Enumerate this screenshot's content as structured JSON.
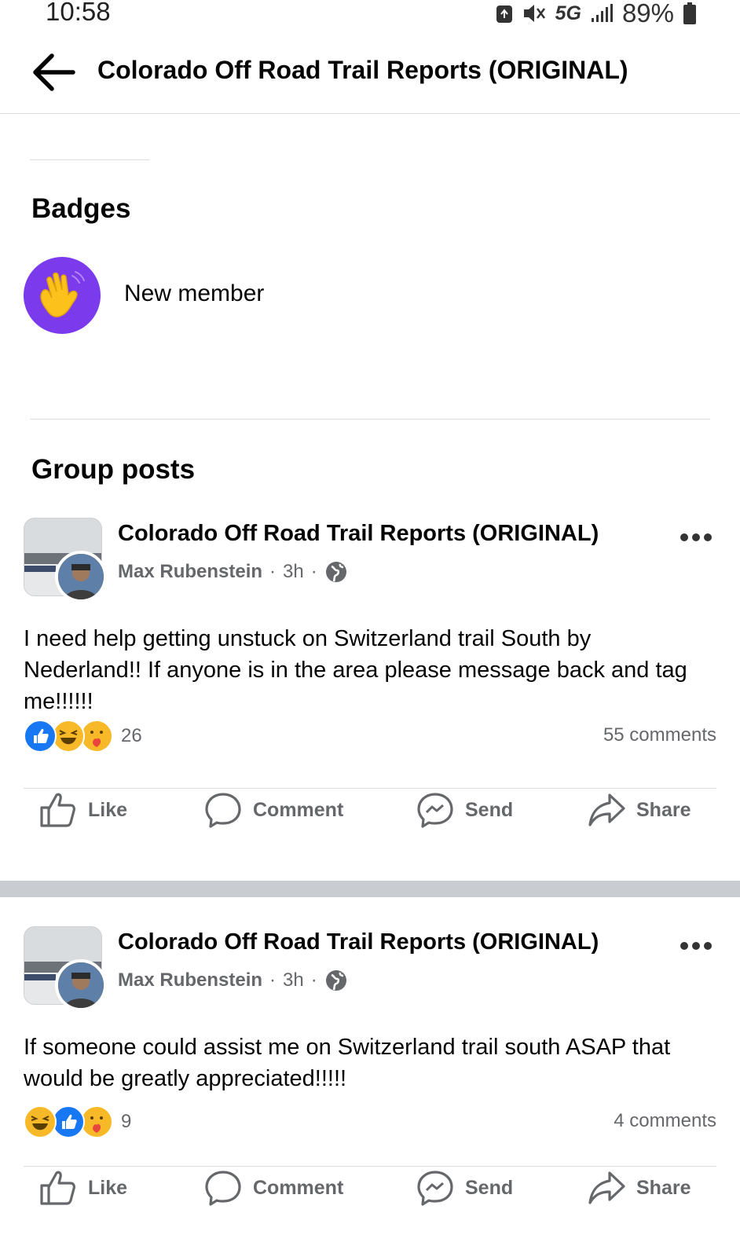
{
  "status_bar": {
    "time": "10:58",
    "network": "5G",
    "battery": "89%"
  },
  "header": {
    "title": "Colorado Off Road Trail Reports (ORIGINAL)"
  },
  "badges": {
    "title": "Badges",
    "items": [
      {
        "label": "New member",
        "icon": "waving-hand-icon"
      }
    ]
  },
  "group_posts": {
    "title": "Group posts",
    "posts": [
      {
        "group": "Colorado Off Road Trail Reports (ORIGINAL)",
        "author": "Max Rubenstein",
        "time": "3h",
        "text": "I need help getting unstuck on Switzerland trail South by Nederland!! If anyone is in the area please message back and tag me!!!!!!",
        "reaction_count": "26",
        "comments": "55 comments"
      },
      {
        "group": "Colorado Off Road Trail Reports (ORIGINAL)",
        "author": "Max Rubenstein",
        "time": "3h",
        "text": "If someone could assist me on Switzerland trail south ASAP that would be greatly appreciated!!!!!",
        "reaction_count": "9",
        "comments": "4 comments"
      }
    ]
  },
  "actions": {
    "like": "Like",
    "comment": "Comment",
    "send": "Send",
    "share": "Share"
  },
  "colors": {
    "like_blue": "#1877f2",
    "badge_purple": "#7c3aed",
    "haha_yellow": "#f7b928",
    "care_red": "#e8453c"
  }
}
